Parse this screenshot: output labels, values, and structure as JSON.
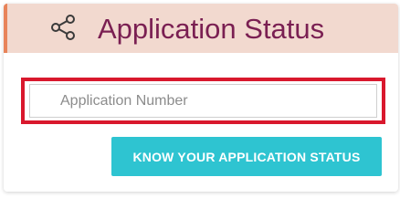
{
  "header": {
    "title": "Application Status",
    "icon": "share-icon"
  },
  "form": {
    "application_number_placeholder": "Application Number",
    "application_number_value": "",
    "submit_label": "KNOW YOUR APPLICATION STATUS"
  },
  "colors": {
    "header_background": "#f2d9cf",
    "header_accent": "#e8845a",
    "title_text": "#7a1f52",
    "highlight_outline": "#d9182d",
    "button_background": "#2ec4d1",
    "button_text": "#ffffff"
  }
}
